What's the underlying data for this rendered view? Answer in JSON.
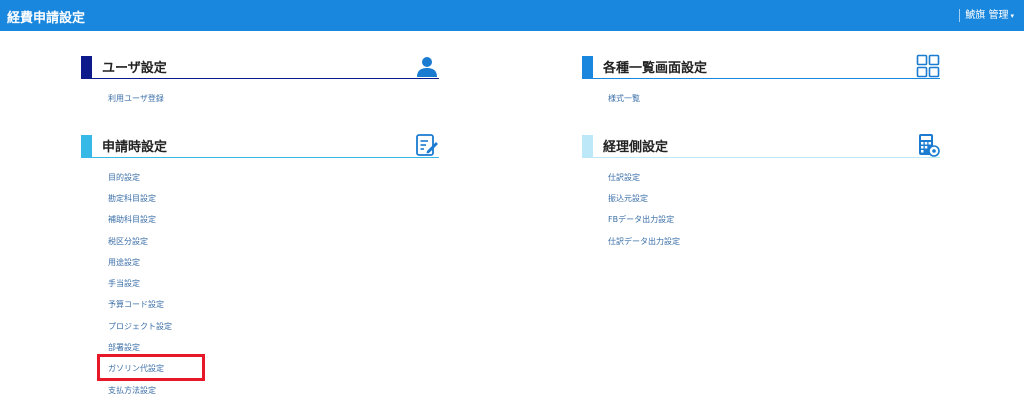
{
  "header": {
    "title": "経費申請設定",
    "user_label": "鯱旗 管理",
    "user_caret": "▾"
  },
  "sections": {
    "user": {
      "title": "ユーザ設定",
      "icon": "person-icon",
      "links": [
        "利用ユーザ登録"
      ]
    },
    "list": {
      "title": "各種一覧画面設定",
      "icon": "grid-icon",
      "links": [
        "様式一覧"
      ]
    },
    "apply": {
      "title": "申請時設定",
      "icon": "edit-document-icon",
      "links": [
        "目的設定",
        "勘定科目設定",
        "補助科目設定",
        "税区分設定",
        "用途設定",
        "手当設定",
        "予算コード設定",
        "プロジェクト設定",
        "部署設定",
        "ガソリン代設定",
        "支払方法設定"
      ]
    },
    "accounting": {
      "title": "経理側設定",
      "icon": "calculator-icon",
      "links": [
        "仕訳設定",
        "振込元設定",
        "FBデータ出力設定",
        "仕訳データ出力設定"
      ]
    }
  },
  "colors": {
    "topbar": "#1a87de",
    "user_bar": "#0d1a8c",
    "list_bar": "#1a87de",
    "apply_bar": "#37b9e8",
    "accounting_bar": "#bde8f7",
    "link": "#3b6fa8",
    "highlight": "#e8182b"
  }
}
